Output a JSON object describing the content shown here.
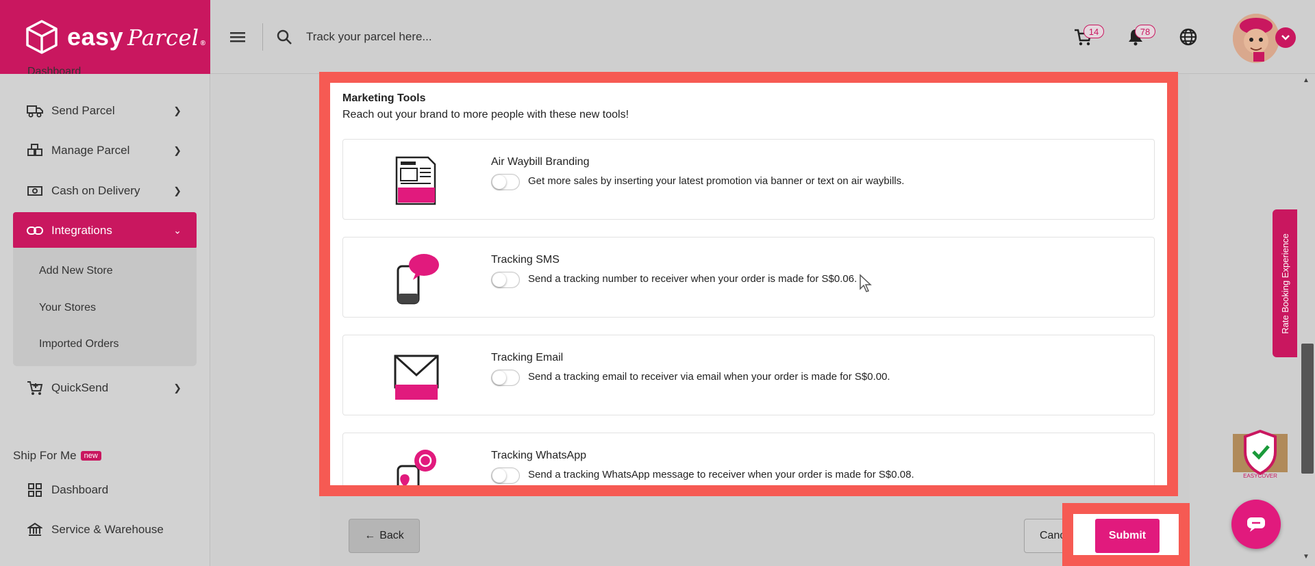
{
  "brand": {
    "name_main": "easy",
    "name_script": "Parcel",
    "reg": "®"
  },
  "sidebar": {
    "partial_item": "Dashboard",
    "items": [
      {
        "label": "Send Parcel",
        "icon": "truck-icon"
      },
      {
        "label": "Manage Parcel",
        "icon": "boxes-icon"
      },
      {
        "label": "Cash on Delivery",
        "icon": "cash-icon"
      },
      {
        "label": "Integrations",
        "icon": "link-icon",
        "active": true
      },
      {
        "label": "QuickSend",
        "icon": "cart-plus-icon"
      }
    ],
    "submenu": [
      "Add New Store",
      "Your Stores",
      "Imported Orders"
    ],
    "section": {
      "title": "Ship For Me",
      "badge": "new"
    },
    "section_items": [
      {
        "label": "Dashboard",
        "icon": "grid-icon"
      },
      {
        "label": "Service & Warehouse",
        "icon": "bank-icon"
      }
    ]
  },
  "topbar": {
    "search_placeholder": "Track your parcel here...",
    "cart_count": "14",
    "notification_count": "78"
  },
  "marketing": {
    "title": "Marketing Tools",
    "description": "Reach out your brand to more people with these new tools!",
    "tools": [
      {
        "name": "Air Waybill Branding",
        "description": "Get more sales by inserting your latest promotion via banner or text on air waybills.",
        "img_label": "Custom AWB",
        "enabled": false
      },
      {
        "name": "Tracking SMS",
        "description": "Send a tracking number to receiver when your order is made for S$0.06.",
        "img_label": "SMS",
        "enabled": false
      },
      {
        "name": "Tracking Email",
        "description": "Send a tracking email to receiver via email when your order is made for S$0.00.",
        "img_label": "Email",
        "enabled": false
      },
      {
        "name": "Tracking WhatsApp",
        "description": "Send a tracking WhatsApp message to receiver when your order is made for S$0.08.",
        "img_label": "",
        "enabled": false
      }
    ]
  },
  "actions": {
    "back": "Back",
    "cancel": "Cancel",
    "submit": "Submit"
  },
  "widgets": {
    "rate_tab": "Rate Booking Experience",
    "easycover_label": "EASYCOVER"
  },
  "colors": {
    "brand": "#c9175f",
    "highlight": "#f65a53",
    "submit": "#e11a7d"
  }
}
